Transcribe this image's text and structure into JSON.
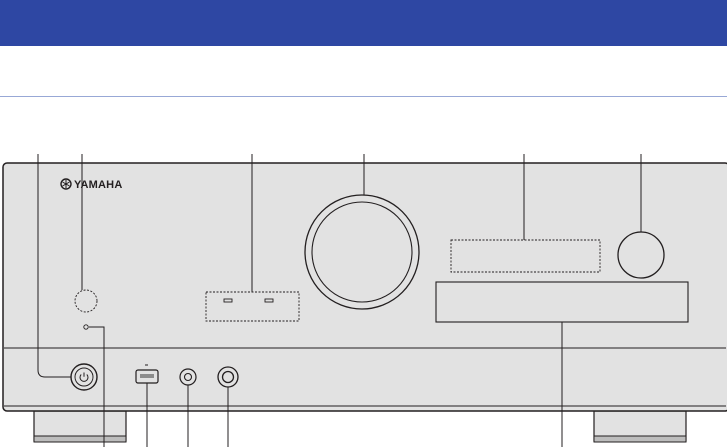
{
  "header": {
    "title": "",
    "banner_color": "#2e47a3"
  },
  "device": {
    "brand": "YAMAHA",
    "brand_logo": "yamaha-tuning-fork-logo",
    "panel_color": "#e2e2e2",
    "outline_color": "#231f20"
  },
  "callout_count": 13
}
